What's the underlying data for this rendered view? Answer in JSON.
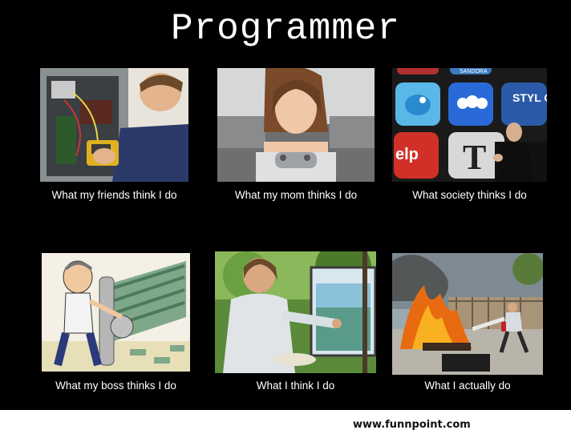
{
  "title": "Programmer",
  "panels": [
    {
      "caption": "What my friends think I do",
      "scene": "technician-fixing-computer"
    },
    {
      "caption": "What my mom thinks I do",
      "scene": "woman-playing-video-game"
    },
    {
      "caption": "What society thinks I do",
      "scene": "app-icons-and-presenter"
    },
    {
      "caption": "What my boss thinks I do",
      "scene": "man-printing-money-cartoon"
    },
    {
      "caption": "What I think I do",
      "scene": "man-painting-on-easel"
    },
    {
      "caption": "What I actually do",
      "scene": "burning-computer-fire-extinguisher"
    }
  ],
  "app_icons": {
    "yelp": "elp",
    "style": "STYL COM",
    "sandora": "SANDORA"
  },
  "watermark": "www.funnpoint.com",
  "colors": {
    "background": "#000000",
    "text": "#ffffff",
    "footer": "#ffffff"
  }
}
